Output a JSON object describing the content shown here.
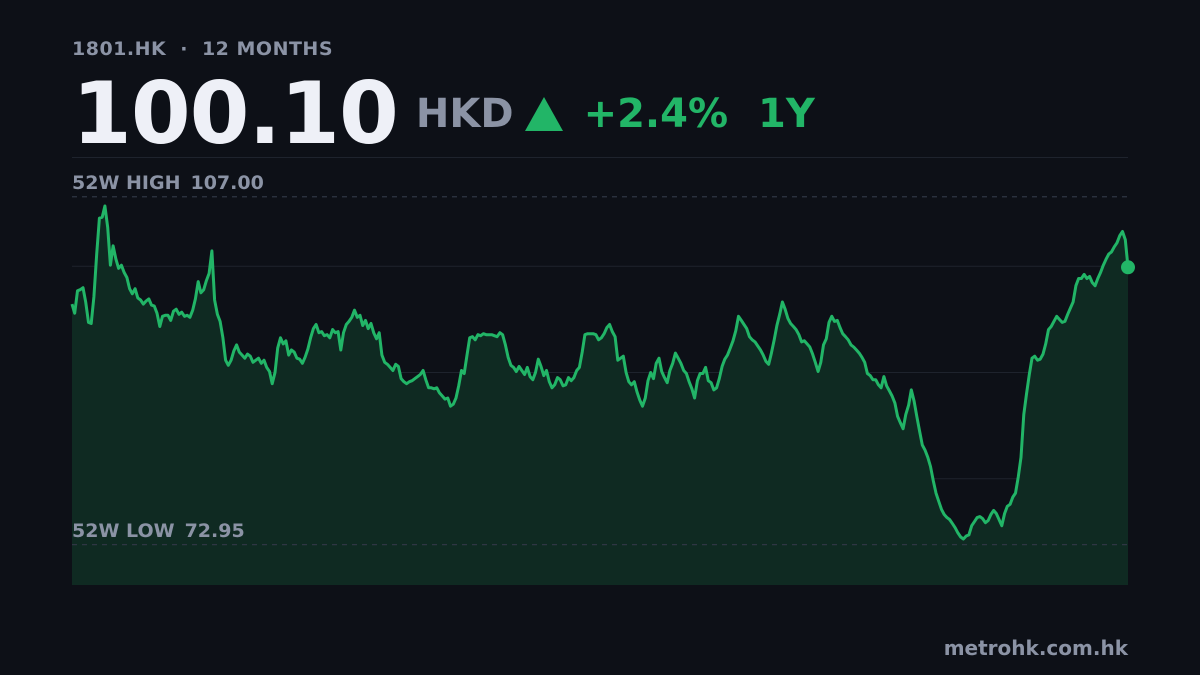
{
  "header": {
    "ticker": "1801.HK",
    "separator": "·",
    "range_label": "12 MONTHS",
    "price": "100.10",
    "currency": "HKD",
    "change": "+2.4%",
    "period": "1Y"
  },
  "labels": {
    "high_label": "52W HIGH",
    "high_value": "107.00",
    "low_label": "52W LOW",
    "low_value": "72.95"
  },
  "footer": {
    "site": "metrohk.com.hk"
  },
  "colors": {
    "background": "#0d1017",
    "accent": "#22b567",
    "area_fill": "#0f2a22",
    "muted_text": "#8b93a5",
    "price_text": "#eef0f7"
  },
  "chart_data": {
    "type": "area",
    "series": [
      {
        "values": [
          96.5,
          95.6,
          97.8,
          97.9,
          98.1,
          96.7,
          94.7,
          94.6,
          97.2,
          101.4,
          104.9,
          105.0,
          106.1,
          104.0,
          100.3,
          102.2,
          100.9,
          100.0,
          100.3,
          99.6,
          99.1,
          98.0,
          97.5,
          98.0,
          97.1,
          96.9,
          96.5,
          96.8,
          97.0,
          96.4,
          96.3,
          95.6,
          94.3,
          95.3,
          95.4,
          95.4,
          94.9,
          95.8,
          96.0,
          95.5,
          95.7,
          95.3,
          95.4,
          95.2,
          95.9,
          97.0,
          98.7,
          97.6,
          97.9,
          98.8,
          99.5,
          101.7,
          96.9,
          95.5,
          94.8,
          93.2,
          91.0,
          90.5,
          91.0,
          91.9,
          92.5,
          91.8,
          91.5,
          91.2,
          91.6,
          91.4,
          90.8,
          91.0,
          91.2,
          90.7,
          91.0,
          90.3,
          89.9,
          88.7,
          89.8,
          92.2,
          93.2,
          92.6,
          92.9,
          91.5,
          92.0,
          91.8,
          91.2,
          91.1,
          90.7,
          91.3,
          92.1,
          93.2,
          94.1,
          94.5,
          93.7,
          93.8,
          93.4,
          93.5,
          93.2,
          94.0,
          93.7,
          93.8,
          92.0,
          93.7,
          94.5,
          94.8,
          95.2,
          95.9,
          95.2,
          95.4,
          94.4,
          94.9,
          94.1,
          94.6,
          93.7,
          93.1,
          93.7,
          91.5,
          90.8,
          90.6,
          90.3,
          90.0,
          90.6,
          90.4,
          89.2,
          88.9,
          88.7,
          88.9,
          89.0,
          89.2,
          89.4,
          89.6,
          90.0,
          89.1,
          88.3,
          88.3,
          88.2,
          88.3,
          87.8,
          87.5,
          87.2,
          87.3,
          86.5,
          86.7,
          87.3,
          88.5,
          90.0,
          89.7,
          91.5,
          93.2,
          93.3,
          93.0,
          93.5,
          93.4,
          93.6,
          93.5,
          93.5,
          93.5,
          93.4,
          93.3,
          93.7,
          93.5,
          92.5,
          91.3,
          90.5,
          90.3,
          89.9,
          90.4,
          90.0,
          89.6,
          90.3,
          89.4,
          89.1,
          89.8,
          91.1,
          90.4,
          89.5,
          90.0,
          88.9,
          88.3,
          88.6,
          89.3,
          89.1,
          88.5,
          88.6,
          89.3,
          89.0,
          89.3,
          90.0,
          90.3,
          91.8,
          93.5,
          93.6,
          93.6,
          93.6,
          93.5,
          93.0,
          93.2,
          93.6,
          94.2,
          94.5,
          93.8,
          93.3,
          91.0,
          91.2,
          91.4,
          89.8,
          88.9,
          88.6,
          88.9,
          87.9,
          87.1,
          86.5,
          87.3,
          89.0,
          89.8,
          89.2,
          90.7,
          91.2,
          89.9,
          89.3,
          88.8,
          90.0,
          90.7,
          91.7,
          91.2,
          90.7,
          90.0,
          89.7,
          88.9,
          88.2,
          87.3,
          89.0,
          89.7,
          89.7,
          90.3,
          89.0,
          88.8,
          88.1,
          88.3,
          89.2,
          90.4,
          91.1,
          91.5,
          92.2,
          92.9,
          93.9,
          95.3,
          94.9,
          94.5,
          94.1,
          93.3,
          93.0,
          92.8,
          92.4,
          92.0,
          91.5,
          90.9,
          90.6,
          91.7,
          93.0,
          94.4,
          95.5,
          96.7,
          96.0,
          95.1,
          94.6,
          94.3,
          94.0,
          93.5,
          92.8,
          92.9,
          92.6,
          92.3,
          91.6,
          90.8,
          89.9,
          90.8,
          92.5,
          93.1,
          94.7,
          95.3,
          94.8,
          94.9,
          94.2,
          93.6,
          93.3,
          93.0,
          92.5,
          92.3,
          92.0,
          91.7,
          91.3,
          90.8,
          89.7,
          89.5,
          89.1,
          89.1,
          88.6,
          88.3,
          89.4,
          88.5,
          88.0,
          87.5,
          86.8,
          85.5,
          84.9,
          84.3,
          85.7,
          86.6,
          88.1,
          87.0,
          85.5,
          84.1,
          82.7,
          82.2,
          81.5,
          80.6,
          79.2,
          78.0,
          77.2,
          76.4,
          75.9,
          75.6,
          75.4,
          75.0,
          74.6,
          74.1,
          73.7,
          73.5,
          73.8,
          73.9,
          74.8,
          75.2,
          75.6,
          75.7,
          75.5,
          75.1,
          75.3,
          75.9,
          76.3,
          76.0,
          75.4,
          74.8,
          76.0,
          76.7,
          76.9,
          77.6,
          78.0,
          79.6,
          81.5,
          85.7,
          87.7,
          89.6,
          91.2,
          91.4,
          91.0,
          91.1,
          91.6,
          92.6,
          94.0,
          94.3,
          94.8,
          95.3,
          95.0,
          94.7,
          94.8,
          95.5,
          96.1,
          96.7,
          98.3,
          99.0,
          99.0,
          99.4,
          99.0,
          99.2,
          98.6,
          98.3,
          99.0,
          99.6,
          100.3,
          100.9,
          101.4,
          101.6,
          102.1,
          102.5,
          103.2,
          103.6,
          102.8,
          100.1
        ]
      }
    ],
    "ylim": [
      69.0,
      110.6
    ],
    "high": 107.0,
    "low": 72.95,
    "grid": true,
    "last_value": 100.1
  }
}
